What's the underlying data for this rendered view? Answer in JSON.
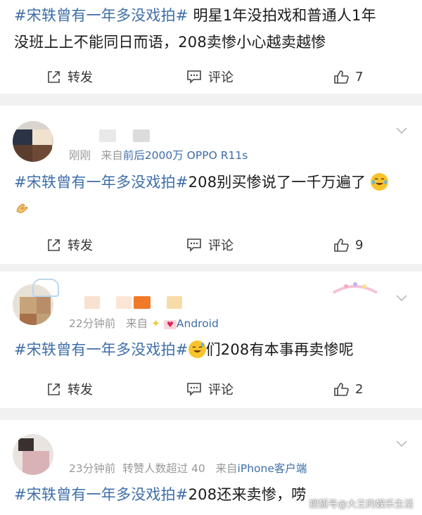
{
  "post": {
    "hashtag": "#宋轶曾有一年多没戏拍#",
    "text_line1_rest": " 明星1年没拍戏和普通人1年",
    "text_line2": "没班上上不能同日而语，208卖惨小心越卖越惨",
    "actions": {
      "forward": "转发",
      "comment": "评论",
      "likes": "7"
    }
  },
  "comments": [
    {
      "time": "刚刚",
      "source_prefix": "来自",
      "source": "前后2000万 OPPO R11s",
      "hashtag": "#宋轶曾有一年多没戏拍#",
      "text": "208别买惨说了一千万遍了",
      "actions": {
        "forward": "转发",
        "comment": "评论",
        "likes": "9"
      }
    },
    {
      "time": "22分钟前",
      "source_prefix": "来自",
      "source": "Android",
      "hashtag": "#宋轶曾有一年多没戏拍#",
      "text": "们208有本事再卖惨呢",
      "actions": {
        "forward": "转发",
        "comment": "评论",
        "likes": "2"
      }
    },
    {
      "time": "23分钟前",
      "extra": "转赞人数超过 40",
      "source_prefix": "来自",
      "source": "iPhone客户端",
      "hashtag": "#宋轶曾有一年多没戏拍#",
      "text": "208还来卖惨，唠"
    }
  ],
  "watermark": "搜狐号@大王的娱乐生活",
  "icons": [
    "forward-icon",
    "comment-icon",
    "like-icon",
    "chevron-down-icon",
    "crying-laugh-emoji",
    "clap-emoji",
    "sweat-smile-emoji",
    "sparkle-emoji",
    "heart-emoji"
  ],
  "colors": {
    "link": "#3e6ea8",
    "text": "#1a1a1a",
    "meta": "#999999",
    "divider": "#f1f1f1"
  }
}
